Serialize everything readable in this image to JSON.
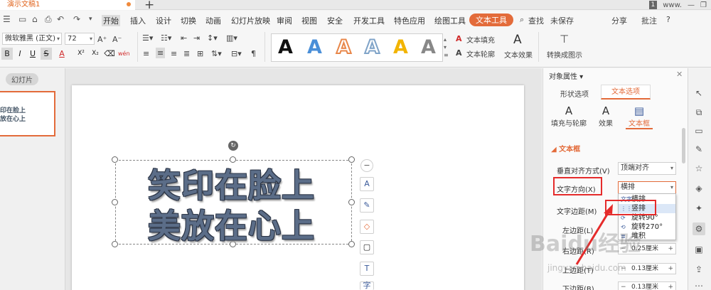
{
  "titlebar": {
    "doc_title": "演示文稿1",
    "plus": "+",
    "page_badge": "1",
    "user": "www.",
    "minimize": "—",
    "restore": "❐"
  },
  "menu": {
    "start": "开始",
    "items": [
      "插入",
      "设计",
      "切换",
      "动画",
      "幻灯片放映",
      "审阅",
      "视图",
      "安全",
      "开发工具",
      "特色应用",
      "绘图工具"
    ],
    "active_tab": "文本工具",
    "search": "查找",
    "unsaved": "未保存",
    "share": "分享",
    "comment": "批注",
    "help": "?"
  },
  "font": {
    "family": "微软雅黑 (正文)",
    "size": "72",
    "bold": "B",
    "italic": "I",
    "underline": "U",
    "strike": "S",
    "color": "A",
    "superscript": "X²",
    "subscript": "X₂",
    "pinyin": "wén"
  },
  "art_gallery": {
    "items": [
      {
        "letter": "A",
        "color": "#111111"
      },
      {
        "letter": "A",
        "color": "#4a8fd8"
      },
      {
        "letter": "A",
        "color": "#e8874a"
      },
      {
        "letter": "A",
        "color": "#7fa3c8"
      },
      {
        "letter": "A",
        "color": "#f2b400"
      },
      {
        "letter": "A",
        "color": "#888888"
      }
    ]
  },
  "text_tools": {
    "fill": "文本填充",
    "outline": "文本轮廓",
    "effect": "文本效果",
    "to_shape": "转换成图示"
  },
  "left_panel": {
    "tab_label": "幻灯片",
    "thumb_line1": "印在脸上",
    "thumb_line2": "放在心上"
  },
  "slide": {
    "line1": "笑印在脸上",
    "line2": "美放在心上"
  },
  "floating_tools": [
    "−",
    "A",
    "✎",
    "◇",
    "▢",
    "T",
    "字"
  ],
  "right_panel": {
    "title": "对象属性",
    "tab_shape": "形状选项",
    "tab_text": "文本选项",
    "sub_fill": "填充与轮廓",
    "sub_effect": "效果",
    "sub_box": "文本框",
    "section": "文本框",
    "vert_align_label": "垂直对齐方式(V)",
    "vert_align_value": "顶端对齐",
    "dir_label": "文字方向(X)",
    "dir_value": "横排",
    "margin_label": "文字边距(M)",
    "left_margin_label": "左边距(L)",
    "right_margin_label": "右边距(R)",
    "top_margin_label": "上边距(T)",
    "bottom_margin_label": "下边距(B)",
    "right_margin_value": "0.25厘米",
    "top_margin_value": "0.13厘米",
    "bottom_margin_value": "0.13厘米",
    "options": [
      "横排",
      "竖排",
      "旋转90°",
      "旋转270°",
      "堆积"
    ]
  },
  "watermark": {
    "main": "Baidu经验",
    "sub": "jingyan.baidu.com"
  }
}
